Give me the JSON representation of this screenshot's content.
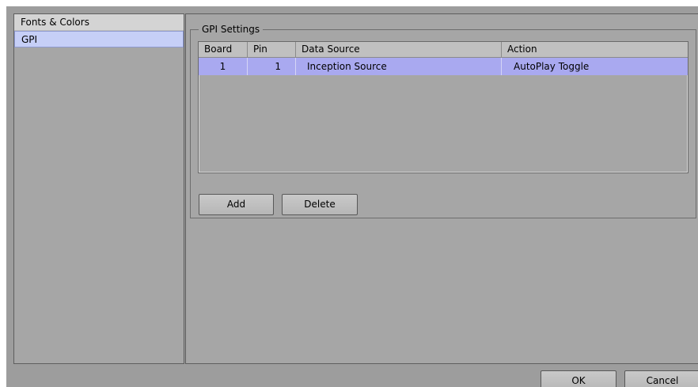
{
  "sidebar": {
    "items": [
      {
        "label": "Fonts & Colors"
      },
      {
        "label": "GPI"
      }
    ]
  },
  "gpi_settings": {
    "title": "GPI Settings",
    "table": {
      "columns": [
        "Board",
        "Pin",
        "Data Source",
        "Action"
      ],
      "rows": [
        {
          "board": "1",
          "pin": "1",
          "data_source": "Inception Source",
          "action": "AutoPlay Toggle"
        }
      ]
    },
    "add_label": "Add",
    "delete_label": "Delete"
  },
  "dialog": {
    "ok_label": "OK",
    "cancel_label": "Cancel"
  },
  "colors": {
    "window_bg": "#9d9d9d",
    "panel_bg": "#a6a6a6",
    "selection": "#a9a9f0"
  }
}
